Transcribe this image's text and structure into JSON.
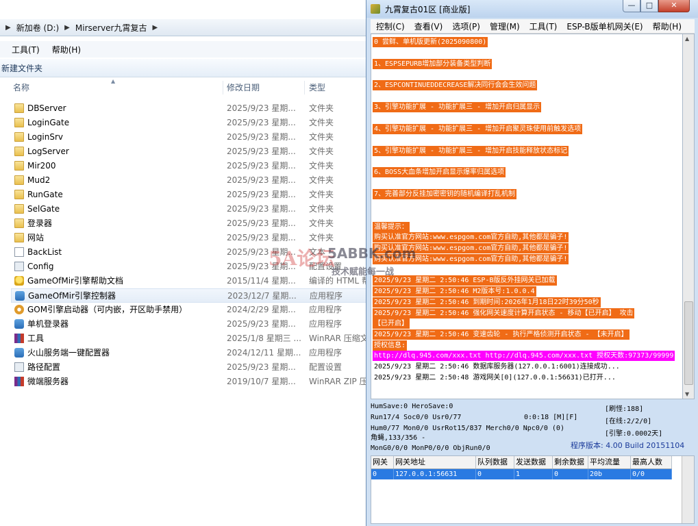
{
  "explorer": {
    "breadcrumb": [
      "新加卷 (D:)",
      "Mirserver九霄复古"
    ],
    "menu": [
      "工具(T)",
      "帮助(H)"
    ],
    "new_folder_label": "新建文件夹",
    "columns": {
      "name": "名称",
      "date": "修改日期",
      "type": "类型"
    },
    "files": [
      {
        "icon": "folder-icon",
        "name": "DBServer",
        "date": "2025/9/23 星期...",
        "type": "文件夹"
      },
      {
        "icon": "folder-icon",
        "name": "LoginGate",
        "date": "2025/9/23 星期...",
        "type": "文件夹"
      },
      {
        "icon": "folder-icon",
        "name": "LoginSrv",
        "date": "2025/9/23 星期...",
        "type": "文件夹"
      },
      {
        "icon": "folder-icon",
        "name": "LogServer",
        "date": "2025/9/23 星期...",
        "type": "文件夹"
      },
      {
        "icon": "folder-icon",
        "name": "Mir200",
        "date": "2025/9/23 星期...",
        "type": "文件夹"
      },
      {
        "icon": "folder-icon",
        "name": "Mud2",
        "date": "2025/9/23 星期...",
        "type": "文件夹"
      },
      {
        "icon": "folder-icon",
        "name": "RunGate",
        "date": "2025/9/23 星期...",
        "type": "文件夹"
      },
      {
        "icon": "folder-icon",
        "name": "SelGate",
        "date": "2025/9/23 星期...",
        "type": "文件夹"
      },
      {
        "icon": "folder-icon",
        "name": "登录器",
        "date": "2025/9/23 星期...",
        "type": "文件夹"
      },
      {
        "icon": "folder-icon",
        "name": "网站",
        "date": "2025/9/23 星期...",
        "type": "文件夹"
      },
      {
        "icon": "text-file-icon",
        "name": "BackList",
        "date": "2025/9/23 星期...",
        "type": "文本"
      },
      {
        "icon": "config-file-icon",
        "name": "Config",
        "date": "2025/9/23 星期...",
        "type": "配置设置"
      },
      {
        "icon": "help-file-icon",
        "name": "GameOfMir引擎帮助文档",
        "date": "2015/11/4 星期...",
        "type": "编译的 HTML 帮"
      },
      {
        "icon": "app-icon",
        "name": "GameOfMir引擎控制器",
        "date": "2023/12/7 星期...",
        "type": "应用程序"
      },
      {
        "icon": "gom-launcher-icon",
        "name": "GOM引擎启动器（可内嵌，开区助手禁用）",
        "date": "2024/2/29 星期...",
        "type": "应用程序"
      },
      {
        "icon": "app-icon",
        "name": "单机登录器",
        "date": "2025/9/23 星期...",
        "type": "应用程序"
      },
      {
        "icon": "winrar-icon",
        "name": "工具",
        "date": "2025/1/8 星期三 ...",
        "type": "WinRAR 压缩文"
      },
      {
        "icon": "app-icon",
        "name": "火山服务端一键配置器",
        "date": "2024/12/11 星期...",
        "type": "应用程序"
      },
      {
        "icon": "config-file-icon",
        "name": "路径配置",
        "date": "2025/9/23 星期...",
        "type": "配置设置"
      },
      {
        "icon": "winrar-icon",
        "name": "微端服务器",
        "date": "2019/10/7 星期...",
        "type": "WinRAR ZIP 压"
      }
    ],
    "selected_index": 13
  },
  "server": {
    "title": "九霄复古01区 [商业版]",
    "menu": [
      "控制(C)",
      "查看(V)",
      "选项(P)",
      "管理(M)",
      "工具(T)",
      "ESP-B版单机网关(E)",
      "帮助(H)"
    ],
    "log": [
      {
        "style": "o",
        "text": "0 尝鲜、单机版更新(2025090800)"
      },
      {
        "style": "blank",
        "text": ""
      },
      {
        "style": "o",
        "text": "1、ESPSEPURB增加部分装备类型判断"
      },
      {
        "style": "blank",
        "text": ""
      },
      {
        "style": "o",
        "text": "2、ESPCONTINUEDDECREASE解决同行会会生效问题"
      },
      {
        "style": "blank",
        "text": ""
      },
      {
        "style": "o",
        "text": "3、引擎功能扩展 - 功能扩展三 - 增加开启归属显示"
      },
      {
        "style": "blank",
        "text": ""
      },
      {
        "style": "o",
        "text": "4、引擎功能扩展 - 功能扩展三 - 增加开启聚灵珠使用前触发选项"
      },
      {
        "style": "blank",
        "text": ""
      },
      {
        "style": "o",
        "text": "5、引擎功能扩展 - 功能扩展三 - 增加开启技能释放状态标记"
      },
      {
        "style": "blank",
        "text": ""
      },
      {
        "style": "o",
        "text": "6、BOSS大血条增加开启显示爆率归属选项"
      },
      {
        "style": "blank",
        "text": ""
      },
      {
        "style": "o",
        "text": "7、完善部分反挂加密密钥的随机编译打乱机制"
      },
      {
        "style": "blank",
        "text": ""
      },
      {
        "style": "blank",
        "text": ""
      },
      {
        "style": "o",
        "text": "温馨提示："
      },
      {
        "style": "o",
        "text": "购买认准官方网站:www.espgom.com官方自助,其他都是骗子!"
      },
      {
        "style": "o",
        "text": "购买认准官方网站:www.espgom.com官方自助,其他都是骗子!"
      },
      {
        "style": "o",
        "text": "购买认准官方网站:www.espgom.com官方自助,其他都是骗子!"
      },
      {
        "style": "blank",
        "text": ""
      },
      {
        "style": "o",
        "text": "2025/9/23 星期二 2:50:46 ESP-B版反外挂网关已加载"
      },
      {
        "style": "o",
        "text": "2025/9/23 星期二 2:50:46 M2版本号:1.0.0.4"
      },
      {
        "style": "o",
        "text": "2025/9/23 星期二 2:50:46 到期时间:2026年1月18日22时39分50秒"
      },
      {
        "style": "o",
        "text": "2025/9/23 星期二 2:50:46 强化网关速度计算开启状态 - 移动【已开启】 攻击"
      },
      {
        "style": "o",
        "text": "【已开启】"
      },
      {
        "style": "o",
        "text": "2025/9/23 星期二 2:50:46 变速齿轮 - 执行严格侦测开启状态 - 【未开启】"
      },
      {
        "style": "o",
        "text": "授权信息:"
      },
      {
        "style": "m",
        "text": "http://dlq.945.com/xxx.txt http://dlq.945.com/xxx.txt 授权天数:97373/99999"
      },
      {
        "style": "p",
        "text": "2025/9/23 星期二 2:50:46 数据库服务器(127.0.0.1:6001)连接成功..."
      },
      {
        "style": "p",
        "text": "2025/9/23 星期二 2:50:48 游戏网关[0](127.0.0.1:56631)已打开..."
      }
    ],
    "stats": {
      "line1": "HumSave:0 HeroSave:0",
      "line2a": "Run17/4 Soc0/0 Usr0/77",
      "line2b": "0:0:18 [M][F]",
      "line3": "Hum0/77 Mon0/0 UsrRot15/837 Merch0/0 Npc0/0 (0)",
      "line4": "角蝇,133/356 -",
      "line5": "MonG0/0/0 MonP0/0/0 ObjRun0/0",
      "refresh": "[刷怪:188]",
      "online": "[在线:2/2/0]",
      "engine": "[引擎:0.0002天]",
      "version": "程序版本: 4.00 Build 20151104"
    },
    "gateway_table": {
      "headers": [
        "网关",
        "网关地址",
        "队列数据",
        "发送数据",
        "剩余数据",
        "平均流量",
        "最高人数"
      ],
      "rows": [
        [
          "0",
          "127.0.0.1:56631",
          "0",
          "1",
          "0",
          "20b",
          "0/0"
        ]
      ]
    }
  },
  "watermark": {
    "logo_text": "5A论坛",
    "site": "5ABBK.com",
    "slogan": "技术赋能每一战"
  }
}
